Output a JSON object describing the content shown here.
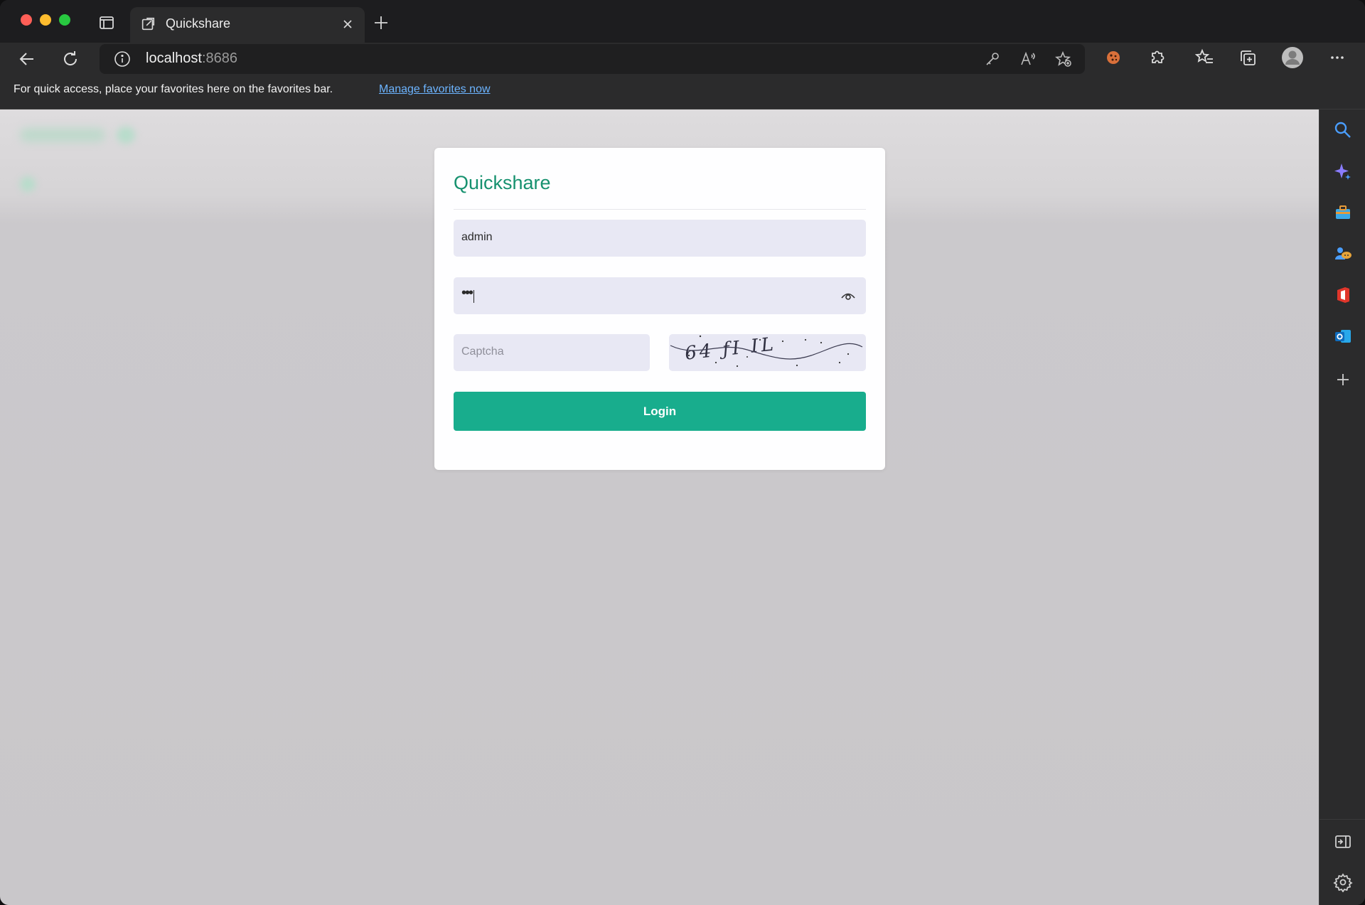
{
  "browser": {
    "tab": {
      "title": "Quickshare"
    },
    "address": {
      "host": "localhost",
      "port": ":8686"
    },
    "favorites_bar": {
      "message": "For quick access, place your favorites here on the favorites bar.",
      "link": "Manage favorites now"
    },
    "toolbar_icons": [
      "back-icon",
      "refresh-icon",
      "info-icon",
      "key-icon",
      "read-aloud-icon",
      "add-favorite-icon",
      "cookie-extension-icon",
      "extensions-icon",
      "favorites-icon",
      "collections-icon",
      "profile-avatar",
      "more-icon"
    ],
    "sidebar_icons": [
      "search-icon",
      "copilot-icon",
      "tools-icon",
      "games-icon",
      "office-icon",
      "outlook-icon",
      "add-icon",
      "hide-sidebar-icon",
      "settings-icon"
    ]
  },
  "login": {
    "title": "Quickshare",
    "username_value": "admin",
    "password_mask": "•••",
    "captcha_placeholder": "Captcha",
    "captcha_image_text": "64 ƒI IL",
    "login_label": "Login"
  },
  "colors": {
    "accent": "#18ad8d",
    "title": "#16916f",
    "field_bg": "#e8e8f4"
  }
}
